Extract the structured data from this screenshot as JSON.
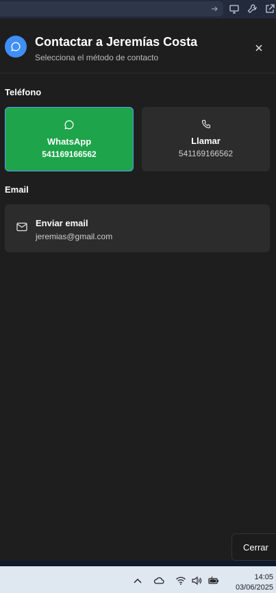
{
  "dialog": {
    "title": "Contactar a Jeremías Costa",
    "subtitle": "Selecciona el método de contacto"
  },
  "phone_section": {
    "label": "Teléfono",
    "whatsapp": {
      "name": "WhatsApp",
      "number": "541169166562"
    },
    "call": {
      "name": "Llamar",
      "number": "541169166562"
    }
  },
  "email_section": {
    "label": "Email",
    "title": "Enviar email",
    "address": "jeremias@gmail.com"
  },
  "footer": {
    "close_label": "Cerrar"
  },
  "taskbar": {
    "time": "14:05",
    "date": "03/06/2025"
  },
  "colors": {
    "accent_blue": "#3f8ff7",
    "whatsapp_green": "#1ea44a",
    "surface": "#2c2c2c",
    "background": "#1e1e1e"
  }
}
